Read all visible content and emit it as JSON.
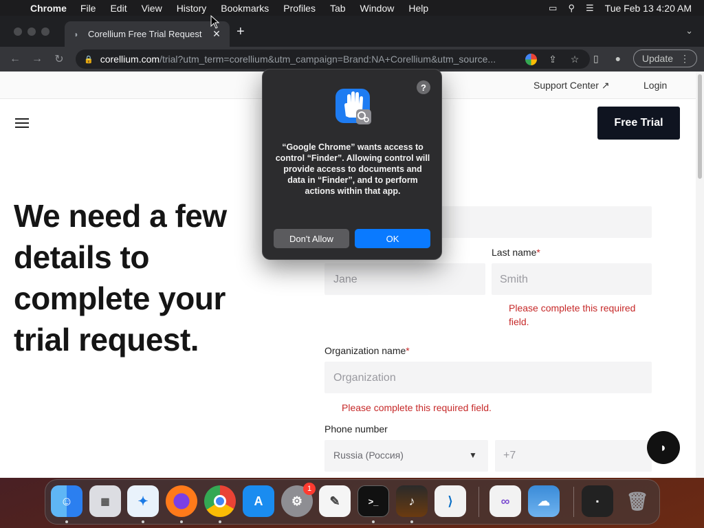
{
  "menubar": {
    "app_name": "Chrome",
    "items": [
      "File",
      "Edit",
      "View",
      "History",
      "Bookmarks",
      "Profiles",
      "Tab",
      "Window",
      "Help"
    ],
    "clock": "Tue Feb 13  4:20 AM"
  },
  "browser": {
    "tab_title": "Corellium Free Trial Request",
    "url_host": "corellium.com",
    "url_path": "/trial?utm_term=corellium&utm_campaign=Brand:NA+Corellium&utm_source...",
    "update_label": "Update"
  },
  "page": {
    "support_center": "Support Center",
    "login": "Login",
    "free_trial": "Free Trial",
    "headline": "We need a few details to complete your trial request.",
    "last_name_label": "Last name",
    "required_mark": "*",
    "first_name_placeholder": "Jane",
    "last_name_placeholder": "Smith",
    "last_name_error": "Please complete this required field.",
    "org_label": "Organization name",
    "org_placeholder": "Organization",
    "org_error": "Please complete this required field.",
    "phone_label": "Phone number",
    "country_selected": "Russia (Россия)",
    "phone_prefix": "+7"
  },
  "dialog": {
    "message": "“Google Chrome” wants access to control “Finder”. Allowing control will provide access to documents and data in “Finder”, and to perform actions within that app.",
    "help": "?",
    "dont_allow": "Don't Allow",
    "ok": "OK",
    "icon": "hand-stop-gear-icon"
  },
  "dock": {
    "apps": [
      "Finder",
      "Launchpad",
      "Safari",
      "Firefox",
      "Chrome",
      "App Store",
      "System Settings",
      "TextEdit",
      "Terminal",
      "GarageBand",
      "VS Code",
      "Visual Studio",
      "Weather",
      "Screenshot",
      "Trash"
    ],
    "settings_badge": "1"
  },
  "colors": {
    "accent_blue": "#0a7aff",
    "error_red": "#c62828",
    "cta_dark": "#0f1420"
  }
}
